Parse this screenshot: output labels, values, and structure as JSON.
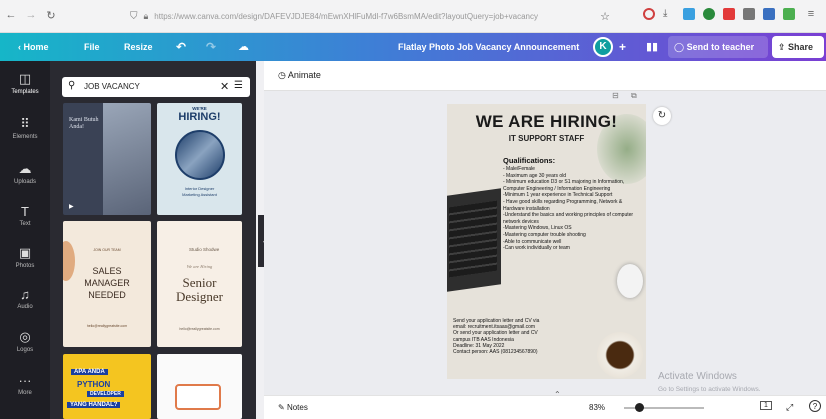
{
  "browser": {
    "url": "https://www.canva.com/design/DAFEVJDJE84/mEwnXHlFuMdl-f7w6BsmMA/edit?layoutQuery=job+vacancy",
    "extension_colors": [
      "#d04040",
      "#3aa0e0",
      "#2a8a3c",
      "#e23a3a",
      "#777777",
      "#3a70c0",
      "#4caf50"
    ]
  },
  "topbar": {
    "home": "Home",
    "file": "File",
    "resize": "Resize",
    "doc_title": "Flatlay Photo Job Vacancy Announcement",
    "avatar_letter": "K",
    "send": "Send to teacher",
    "share": "Share"
  },
  "sidebar": {
    "items": [
      "Templates",
      "Elements",
      "Uploads",
      "Text",
      "Photos",
      "Audio",
      "Logos",
      "More"
    ]
  },
  "search": {
    "query": "JOB VACANCY"
  },
  "templates": {
    "t1": {
      "text": "Kami Butuh Anda!"
    },
    "t2": {
      "badge": "WE'RE",
      "headline": "HIRING!",
      "role": "Interior Designer",
      "role2": "Marketing Assistant"
    },
    "t3": {
      "header": "JOIN OUR TEAM",
      "headline": "SALES MANAGER NEEDED",
      "contact": "hello@reallygreatsite.com"
    },
    "t4": {
      "brand": "Studio Shodwe",
      "small": "We are Hiring",
      "headline": "Senior Designer",
      "contact": "hello@reallygreatsite.com"
    },
    "t5": {
      "line1": "APA ANDA",
      "line2": "PYTHON",
      "line3": "DEVELOPER",
      "line4": "YANG HANDAL?"
    }
  },
  "canvas": {
    "animate": "Animate"
  },
  "poster": {
    "title": "WE ARE HIRING!",
    "subtitle": "IT SUPPORT STAFF",
    "qual_head": "Qualifications:",
    "qualifications": [
      "- Male/Female",
      "- Maximum age 30 years old",
      "- Minimum education D3 or S1 majoring in Information, Computer Engineering / Information Engineering",
      "-Minimum 1 year experience in Technical Support",
      "- Have good skills regarding Programming, Network & Hardware installation",
      "-Understand the basics and working principles of computer network devices",
      "-Mastering Windows, Linux OS",
      "-Mastering computer trouble shooting",
      "-Able to communicate well",
      "-Can work individually or team"
    ],
    "footer": [
      "Send your application letter and CV via",
      "email: recruitment.itsaas@gmail.com",
      "Or send your application letter and CV",
      "campus ITB AAS Indonesia",
      "Deadline: 31 May 2022",
      "Contact person: AAS (081234567890)"
    ]
  },
  "bottombar": {
    "notes": "Notes",
    "zoom": "83%",
    "zoom_level": 0.83,
    "page": "1"
  },
  "watermark": {
    "line1": "Activate Windows",
    "line2": "Go to Settings to activate Windows."
  }
}
